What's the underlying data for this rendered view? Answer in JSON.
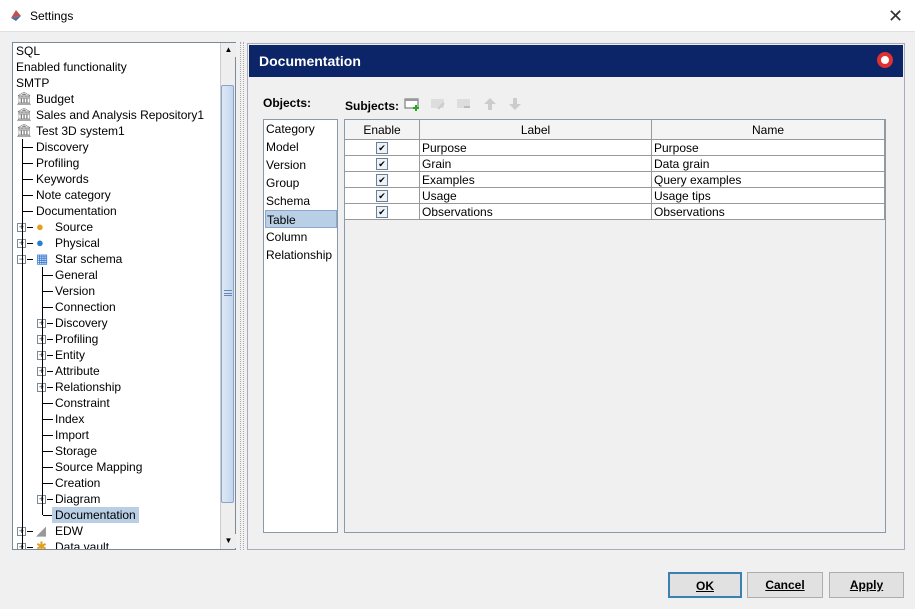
{
  "window": {
    "title": "Settings"
  },
  "tree": [
    {
      "label": "SQL",
      "lv": 0
    },
    {
      "label": "Enabled functionality",
      "lv": 0
    },
    {
      "label": "SMTP",
      "lv": 0
    },
    {
      "label": "Budget",
      "lv": 0,
      "icon": "bank"
    },
    {
      "label": "Sales and Analysis Repository1",
      "lv": 0,
      "icon": "bank"
    },
    {
      "label": "Test 3D system1",
      "lv": 0,
      "icon": "bank"
    },
    {
      "label": "Discovery",
      "lv": 1
    },
    {
      "label": "Profiling",
      "lv": 1
    },
    {
      "label": "Keywords",
      "lv": 1
    },
    {
      "label": "Note category",
      "lv": 1
    },
    {
      "label": "Documentation",
      "lv": 1
    },
    {
      "label": "Source",
      "lv": 1,
      "exp": "+",
      "icon": "source"
    },
    {
      "label": "Physical",
      "lv": 1,
      "exp": "+",
      "icon": "physical"
    },
    {
      "label": "Star schema",
      "lv": 1,
      "exp": "-",
      "icon": "star"
    },
    {
      "label": "General",
      "lv": 2
    },
    {
      "label": "Version",
      "lv": 2
    },
    {
      "label": "Connection",
      "lv": 2
    },
    {
      "label": "Discovery",
      "lv": 2,
      "exp": "+"
    },
    {
      "label": "Profiling",
      "lv": 2,
      "exp": "+"
    },
    {
      "label": "Entity",
      "lv": 2,
      "exp": "+"
    },
    {
      "label": "Attribute",
      "lv": 2,
      "exp": "+"
    },
    {
      "label": "Relationship",
      "lv": 2,
      "exp": "+"
    },
    {
      "label": "Constraint",
      "lv": 2
    },
    {
      "label": "Index",
      "lv": 2
    },
    {
      "label": "Import",
      "lv": 2
    },
    {
      "label": "Storage",
      "lv": 2
    },
    {
      "label": "Source Mapping",
      "lv": 2
    },
    {
      "label": "Creation",
      "lv": 2
    },
    {
      "label": "Diagram",
      "lv": 2,
      "exp": "+"
    },
    {
      "label": "Documentation",
      "lv": 2,
      "selected": true
    },
    {
      "label": "EDW",
      "lv": 1,
      "exp": "+",
      "icon": "edw"
    },
    {
      "label": "Data vault",
      "lv": 1,
      "exp": "+",
      "icon": "vault"
    }
  ],
  "panel": {
    "title": "Documentation",
    "objects_label": "Objects:",
    "subjects_label": "Subjects:"
  },
  "objects": [
    "Category",
    "Model",
    "Version",
    "Group",
    "Schema",
    "Table",
    "Column",
    "Relationship"
  ],
  "objects_selected": "Table",
  "table": {
    "columns": [
      "Enable",
      "Label",
      "Name"
    ],
    "rows": [
      {
        "enabled": true,
        "label": "Purpose",
        "name": "Purpose"
      },
      {
        "enabled": true,
        "label": "Grain",
        "name": "Data grain"
      },
      {
        "enabled": true,
        "label": "Examples",
        "name": "Query examples"
      },
      {
        "enabled": true,
        "label": "Usage",
        "name": "Usage tips"
      },
      {
        "enabled": true,
        "label": "Observations",
        "name": "Observations"
      }
    ]
  },
  "buttons": {
    "ok": "OK",
    "cancel": "Cancel",
    "apply": "Apply"
  },
  "colors": {
    "header": "#0c2468",
    "selection": "#b8cfe5"
  }
}
